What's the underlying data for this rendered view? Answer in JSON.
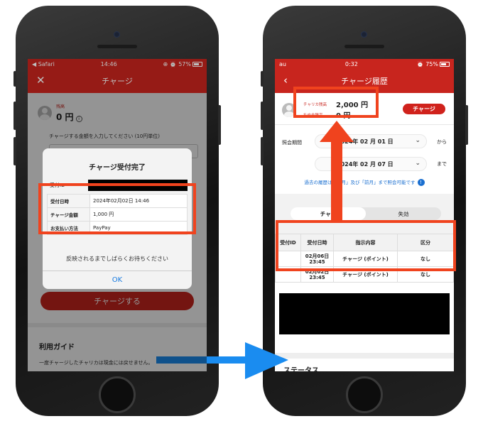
{
  "left_phone": {
    "status": {
      "carrier": "◀ Safari",
      "time": "14:46",
      "battery": "⊕ ⏰ 57%"
    },
    "nav": {
      "close_icon": "close-icon",
      "title": "チャージ"
    },
    "balance": {
      "label": "残高",
      "amount": "0 円"
    },
    "instruction": "チャージする金額を入力してください (10円単位)",
    "charge_button": "チャージする",
    "guide": {
      "title": "利用ガイド",
      "text": "一度チャージしたチャリカは現金には戻せません。"
    },
    "dialog": {
      "title": "チャージ受付完了",
      "id_label": "受付ID",
      "rows": [
        {
          "label": "受付日時",
          "value": "2024年02月02日 14:46"
        },
        {
          "label": "チャージ金額",
          "value": "1,000 円"
        },
        {
          "label": "お支払い方法",
          "value": "PayPay"
        }
      ],
      "message": "反映されるまでしばらくお待ちください",
      "ok": "OK"
    }
  },
  "right_phone": {
    "status": {
      "carrier": "au",
      "time": "0:32",
      "battery": "⏰ 75%"
    },
    "nav": {
      "back_icon": "back-icon",
      "title": "チャージ履歴"
    },
    "balances": [
      {
        "label": "チャリカ残高",
        "value": "2,000 円"
      },
      {
        "label": "払戻金残高",
        "value": "0 円"
      }
    ],
    "charge_button": "チャージ",
    "period_label": "照会期間",
    "date_from": "2024年 02 月 01 日",
    "date_to": "2024年 02 月 07 日",
    "from_suffix": "から",
    "to_suffix": "まで",
    "note": "過去の履歴は「当月」及び「前月」まで照会可能です",
    "tabs": [
      "チャー",
      "失効"
    ],
    "table": {
      "headers": [
        "受付ID",
        "受付日時",
        "指示内容",
        "区分"
      ],
      "rows": [
        {
          "id": "",
          "date": "02月06日",
          "time": "23:45",
          "content": "チャージ (ポイント)",
          "kind": "なし"
        },
        {
          "id": "",
          "date": "02月02日",
          "time": "23:45",
          "content": "チャージ (ポイント)",
          "kind": "なし"
        }
      ]
    },
    "status_title": "ステータス"
  },
  "colors": {
    "brand_red": "#c8251e",
    "highlight": "#f0431e",
    "arrow_blue": "#1a8cf0",
    "link_blue": "#1a6fd0"
  }
}
